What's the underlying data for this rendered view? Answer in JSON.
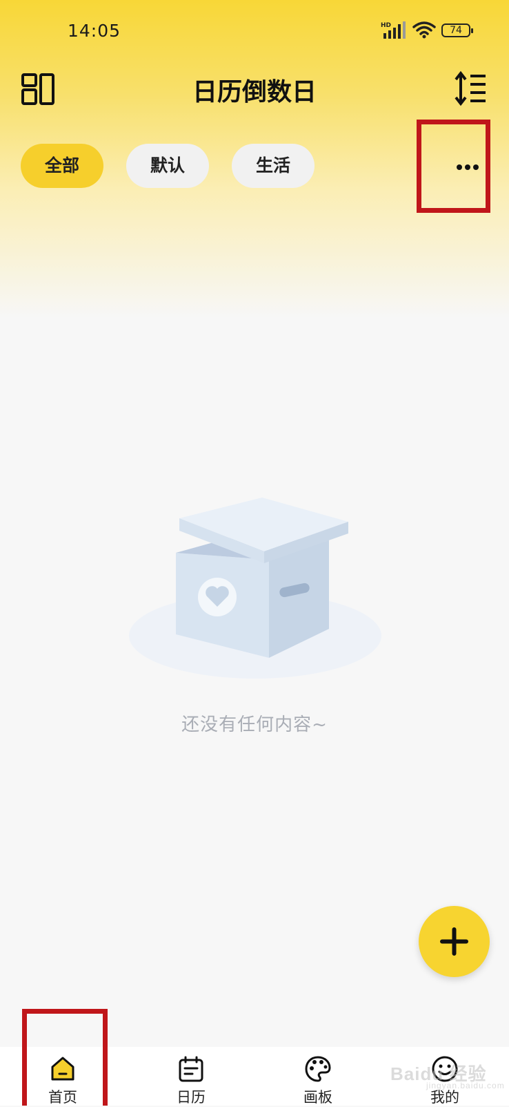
{
  "status_bar": {
    "time": "14:05",
    "network": "HD",
    "battery": "74"
  },
  "header": {
    "title": "日历倒数日",
    "left_icon": "layout-grid-icon",
    "right_icon": "sort-icon"
  },
  "tabs": [
    {
      "label": "全部",
      "active": true
    },
    {
      "label": "默认",
      "active": false
    },
    {
      "label": "生活",
      "active": false
    }
  ],
  "more_icon": "more-horizontal-icon",
  "empty_state": {
    "message": "还没有任何内容~",
    "icon": "empty-box-illustration"
  },
  "fab_icon": "plus-icon",
  "bottom_nav": [
    {
      "label": "首页",
      "icon": "home-icon",
      "active": true
    },
    {
      "label": "日历",
      "icon": "calendar-icon",
      "active": false
    },
    {
      "label": "画板",
      "icon": "palette-icon",
      "active": false
    },
    {
      "label": "我的",
      "icon": "smile-icon",
      "active": false
    }
  ],
  "watermark": {
    "text": "Baidu 经验",
    "sub": "jingyan.baidu.com"
  },
  "colors": {
    "accent": "#f6cf2c",
    "highlight_box": "#c0161a",
    "empty_text": "#a9adb5"
  }
}
